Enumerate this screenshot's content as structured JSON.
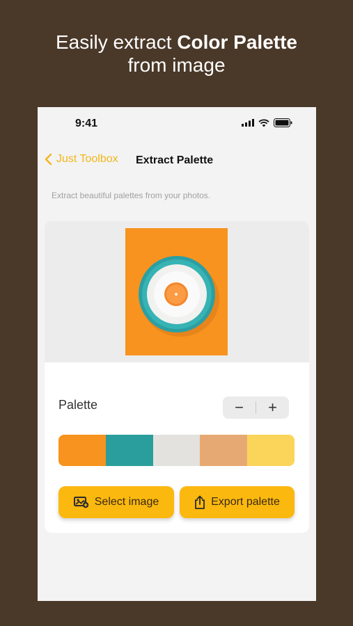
{
  "headline": {
    "normal": "Easily extract ",
    "bold": "Color Palette",
    "line2": "from image"
  },
  "status": {
    "time": "9:41"
  },
  "nav": {
    "back_label": "Just Toolbox",
    "title": "Extract Palette"
  },
  "subtitle": "Extract beautiful palettes from your photos.",
  "palette": {
    "label": "Palette",
    "minus": "−",
    "plus": "+",
    "swatches": [
      "#f7931e",
      "#2a9e9c",
      "#e3e2df",
      "#e7a973",
      "#fbd55a"
    ]
  },
  "actions": {
    "select_image": "Select image",
    "export_palette": "Export palette"
  },
  "colors": {
    "accent": "#fbb80f",
    "background": "#4a3828"
  }
}
